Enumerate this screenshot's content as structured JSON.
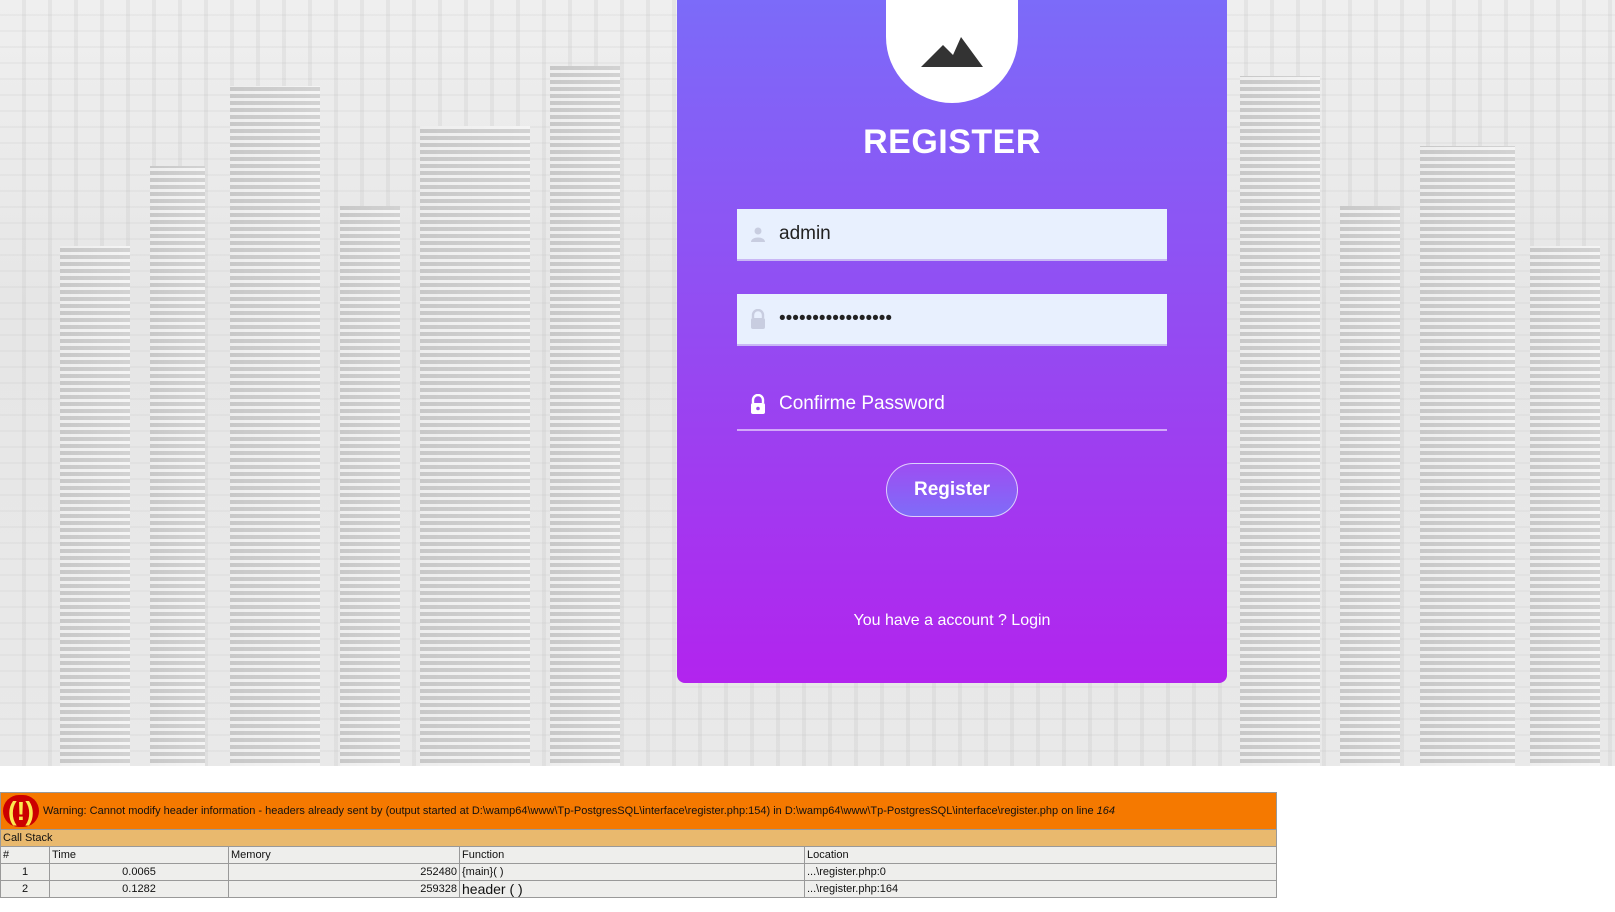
{
  "register_card": {
    "title": "REGISTER",
    "username_value": "admin",
    "password_value": "•••••••••••••••••",
    "confirm_placeholder": "Confirme Password",
    "register_button": "Register",
    "login_prompt": "You have a account ? Login"
  },
  "xdebug": {
    "warning_prefix": "Warning: Cannot modify header information - headers already sent by (output started at D:\\wamp64\\www\\Tp-PostgresSQL\\interface\\register.php:154) in D:\\wamp64\\www\\Tp-PostgresSQL\\interface\\register.php on line ",
    "warning_line": "164",
    "bang": "(!)",
    "call_stack_label": "Call Stack",
    "columns": [
      "#",
      "Time",
      "Memory",
      "Function",
      "Location"
    ],
    "rows": [
      {
        "num": "1",
        "time": "0.0065",
        "memory": "252480",
        "function": "{main}( )",
        "location": "...\\register.php:0"
      },
      {
        "num": "2",
        "time": "0.1282",
        "memory": "259328",
        "function": "header ( )",
        "location": "...\\register.php:164"
      }
    ]
  },
  "colors": {
    "card_top": "#7b6cf9",
    "card_bottom": "#b224ee",
    "warning_bg": "#f57900",
    "callstack_bg": "#e9b96e"
  }
}
